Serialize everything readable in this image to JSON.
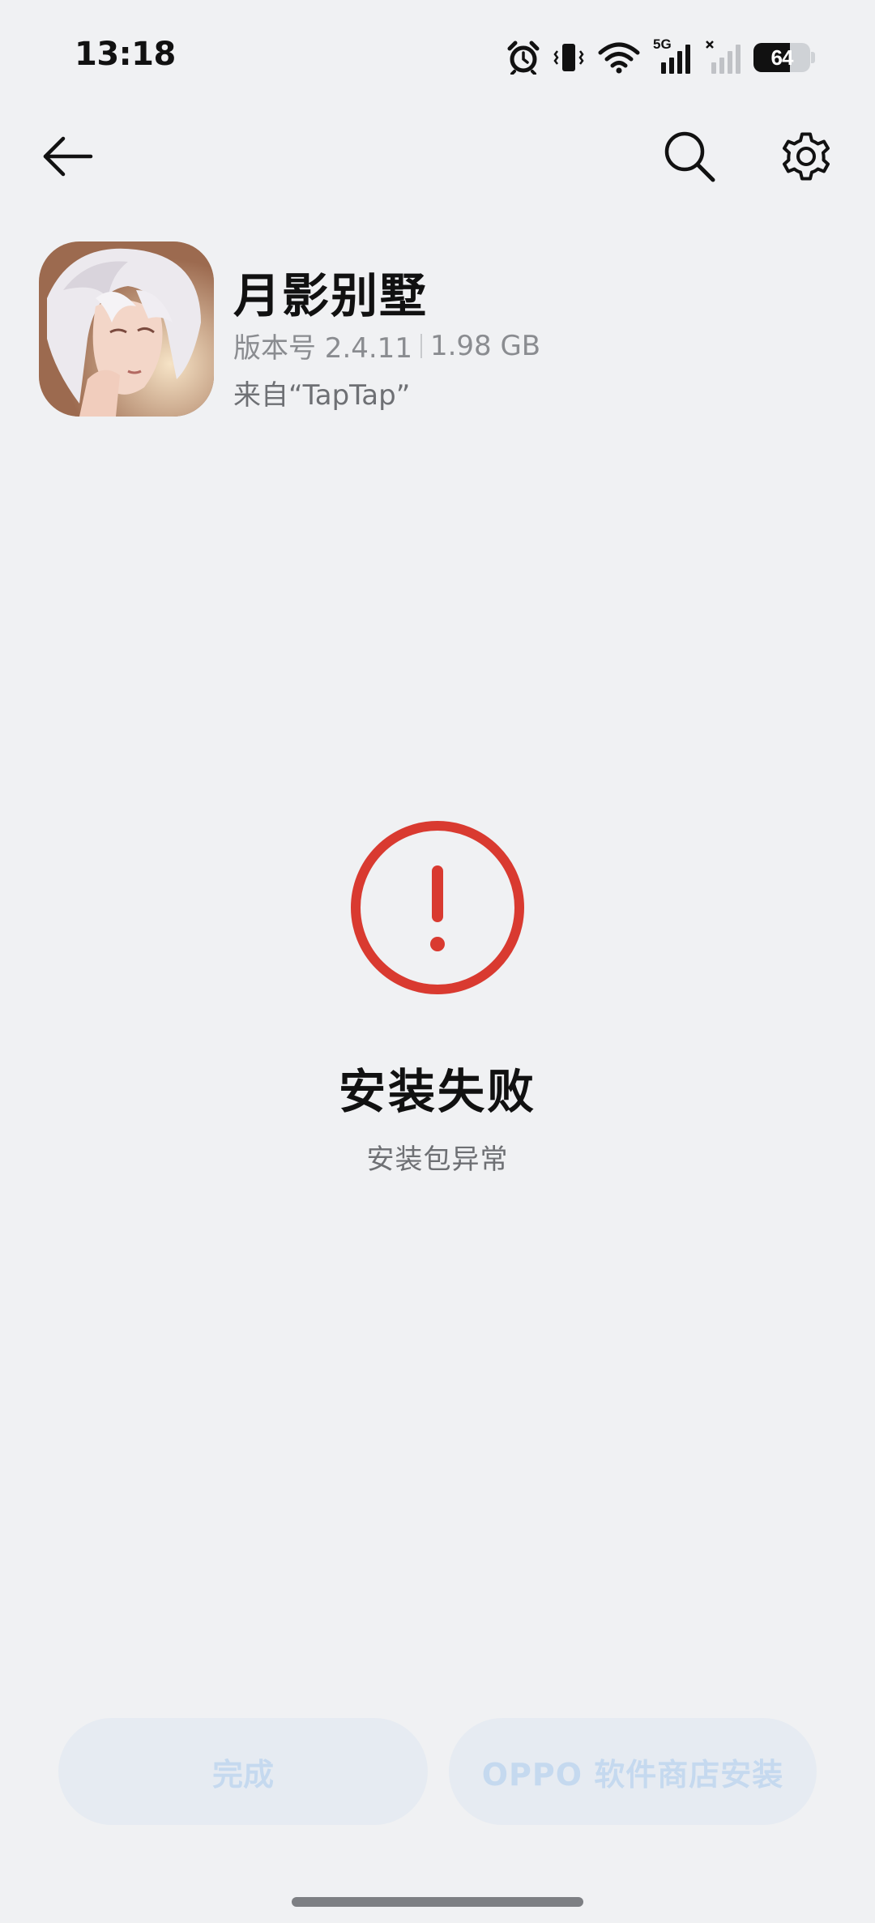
{
  "status_bar": {
    "time": "13:18",
    "network_label": "5G",
    "battery_level": "64",
    "battery_fraction": 0.64,
    "icons": [
      "alarm-icon",
      "vibrate-icon",
      "wifi-icon",
      "signal-5g-icon",
      "signal-no-service-icon",
      "battery-icon"
    ]
  },
  "toolbar": {
    "back_icon": "arrow-left-icon",
    "search_icon": "search-icon",
    "settings_icon": "gear-icon"
  },
  "app": {
    "name": "月影别墅",
    "version": "版本号 2.4.11",
    "size": "1.98 GB",
    "source": "来自“TapTap”"
  },
  "status": {
    "icon": "error-exclamation-icon",
    "title": "安装失败",
    "subtitle": "安装包异常",
    "accent_color": "#d93a30"
  },
  "actions": {
    "done_label": "完成",
    "oppo_store_label": "OPPO 软件商店安装",
    "button_bg": "#e6ebf2",
    "button_text_color": "#c5d9ef"
  }
}
